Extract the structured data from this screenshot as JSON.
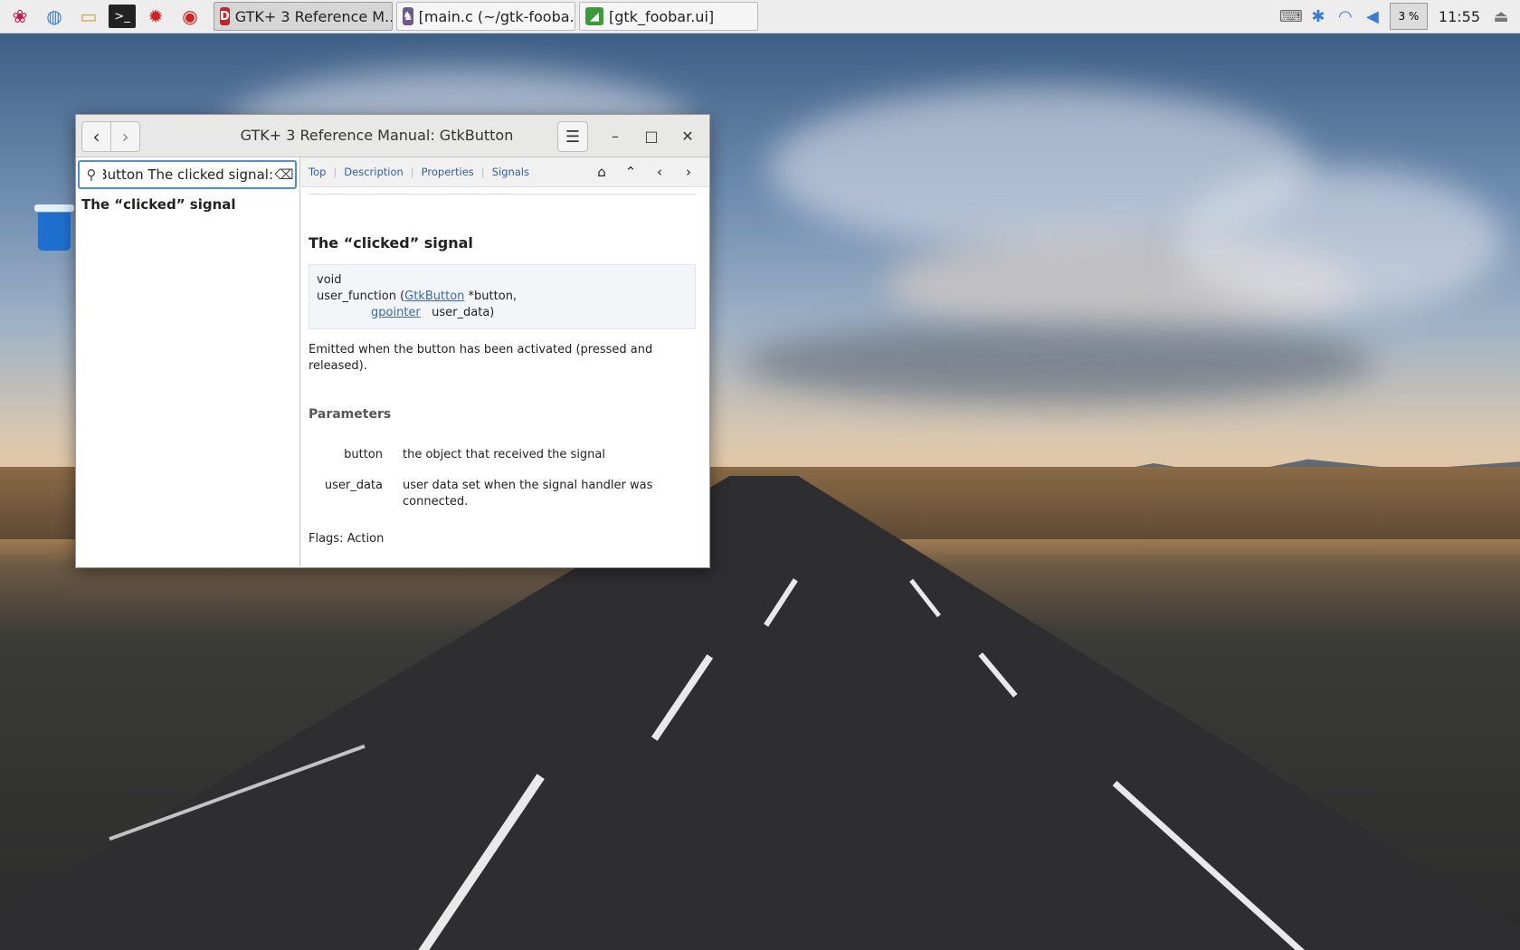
{
  "taskbar": {
    "launchers": [
      {
        "name": "raspberry-menu-icon",
        "glyph": "❀",
        "color": "#c51a4a"
      },
      {
        "name": "web-browser-icon",
        "glyph": "◍",
        "color": "#3a7bd5"
      },
      {
        "name": "file-manager-icon",
        "glyph": "▭",
        "color": "#caa13a"
      },
      {
        "name": "terminal-icon",
        "glyph": ">_",
        "color": "#222"
      },
      {
        "name": "mathematica-icon",
        "glyph": "✹",
        "color": "#d52020"
      },
      {
        "name": "wolfram-icon",
        "glyph": "◉",
        "color": "#d52020"
      }
    ],
    "tasks": [
      {
        "label": "GTK+ 3 Reference M...",
        "icon": "devhelp-icon",
        "icon_glyph": "D",
        "icon_color": "#c0262b",
        "active": true
      },
      {
        "label": "[main.c (~/gtk-fooba...",
        "icon": "geany-icon",
        "icon_glyph": "♞",
        "icon_color": "#6b5a8e",
        "active": false
      },
      {
        "label": "[gtk_foobar.ui]",
        "icon": "glade-icon",
        "icon_glyph": "◢",
        "icon_color": "#3c9a3c",
        "active": false
      }
    ],
    "cpu_usage": "3 %",
    "clock": "11:55"
  },
  "window": {
    "title": "GTK+ 3 Reference Manual: GtkButton",
    "search": {
      "value": ":Button The clicked signal",
      "placeholder": ""
    },
    "results": [
      "The “clicked” signal"
    ],
    "topnav": [
      "Top",
      "Description",
      "Properties",
      "Signals"
    ],
    "doc": {
      "heading": "The “clicked” signal",
      "code_line1": "void",
      "code_line2_prefix": "user_function (",
      "code_type1": "GtkButton",
      "code_line2_suffix": " *button,",
      "code_type2": "gpointer",
      "code_line3_suffix": "user_data)",
      "description": "Emitted when the button has been activated (pressed and released).",
      "params_heading": "Parameters",
      "params": [
        {
          "name": "button",
          "desc": "the object that received the signal"
        },
        {
          "name": "user_data",
          "desc": "user data set when the signal handler was connected."
        }
      ],
      "flags": "Flags: Action"
    }
  }
}
